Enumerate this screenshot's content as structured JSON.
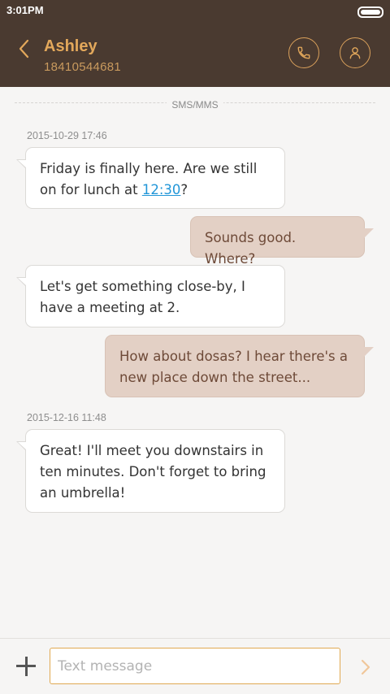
{
  "status": {
    "time": "3:01PM"
  },
  "contact": {
    "name": "Ashley",
    "number": "18410544681"
  },
  "divider_label": "SMS/MMS",
  "timestamps": [
    "2015-10-29 17:46",
    "2015-12-16 11:48"
  ],
  "messages": [
    {
      "direction": "incoming",
      "text_before": "Friday is finally here. Are we still on for lunch at ",
      "link": "12:30",
      "text_after": "?"
    },
    {
      "direction": "outgoing",
      "text": "Sounds good. Where?"
    },
    {
      "direction": "incoming",
      "text": "Let's get something close-by, I have a meeting at 2."
    },
    {
      "direction": "outgoing",
      "text": "How about dosas? I hear there's a new place down the street..."
    },
    {
      "direction": "incoming",
      "text": "Great! I'll meet you downstairs in ten minutes. Don't forget to bring an umbrella!"
    }
  ],
  "composer": {
    "placeholder": "Text message"
  },
  "icons": {
    "back": "back-arrow-icon",
    "call": "phone-icon",
    "profile": "person-icon",
    "attach": "plus-icon",
    "send": "send-arrow-icon"
  },
  "colors": {
    "header_bg": "#4a3a30",
    "accent": "#e3a85b",
    "outgoing_bubble": "#e3d0c5",
    "link": "#2196d8"
  }
}
